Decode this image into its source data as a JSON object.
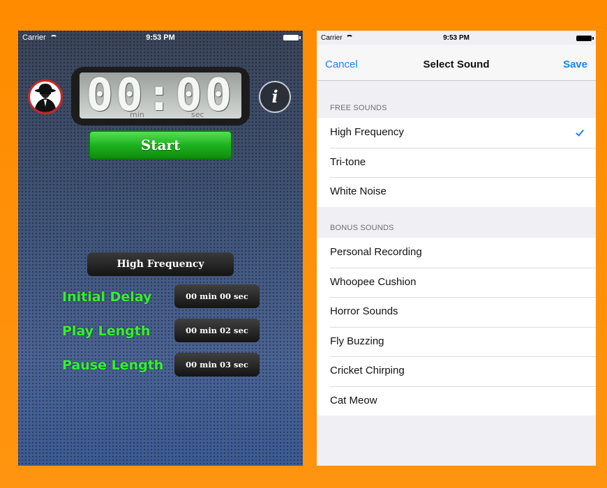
{
  "left_screen": {
    "status_bar": {
      "carrier": "Carrier",
      "time": "9:53 PM"
    },
    "timer": {
      "digits": "00:00",
      "unit_min": "min",
      "unit_sec": "sec"
    },
    "info_label": "i",
    "start_label": "Start",
    "sound_label": "High Frequency",
    "settings": [
      {
        "label": "Initial Delay",
        "value": "00 min 00 sec"
      },
      {
        "label": "Play Length",
        "value": "00 min 02 sec"
      },
      {
        "label": "Pause Length",
        "value": "00 min 03 sec"
      }
    ],
    "colors": {
      "start_green": "#1fb21f",
      "label_green": "#35f02d"
    }
  },
  "right_screen": {
    "status_bar": {
      "carrier": "Carrier",
      "time": "9:53 PM"
    },
    "nav": {
      "cancel": "Cancel",
      "title": "Select Sound",
      "save": "Save"
    },
    "free_header": "FREE SOUNDS",
    "free_sounds": [
      "High Frequency",
      "Tri-tone",
      "White Noise"
    ],
    "selected_sound": "High Frequency",
    "bonus_header": "BONUS SOUNDS",
    "bonus_sounds": [
      "Personal Recording",
      "Whoopee Cushion",
      "Horror Sounds",
      "Fly Buzzing",
      "Cricket Chirping",
      "Cat Meow"
    ],
    "colors": {
      "tint": "#1a82fb"
    }
  },
  "icons": [
    "wifi-icon",
    "battery-icon",
    "spy-avatar-icon",
    "info-icon",
    "checkmark-icon"
  ]
}
